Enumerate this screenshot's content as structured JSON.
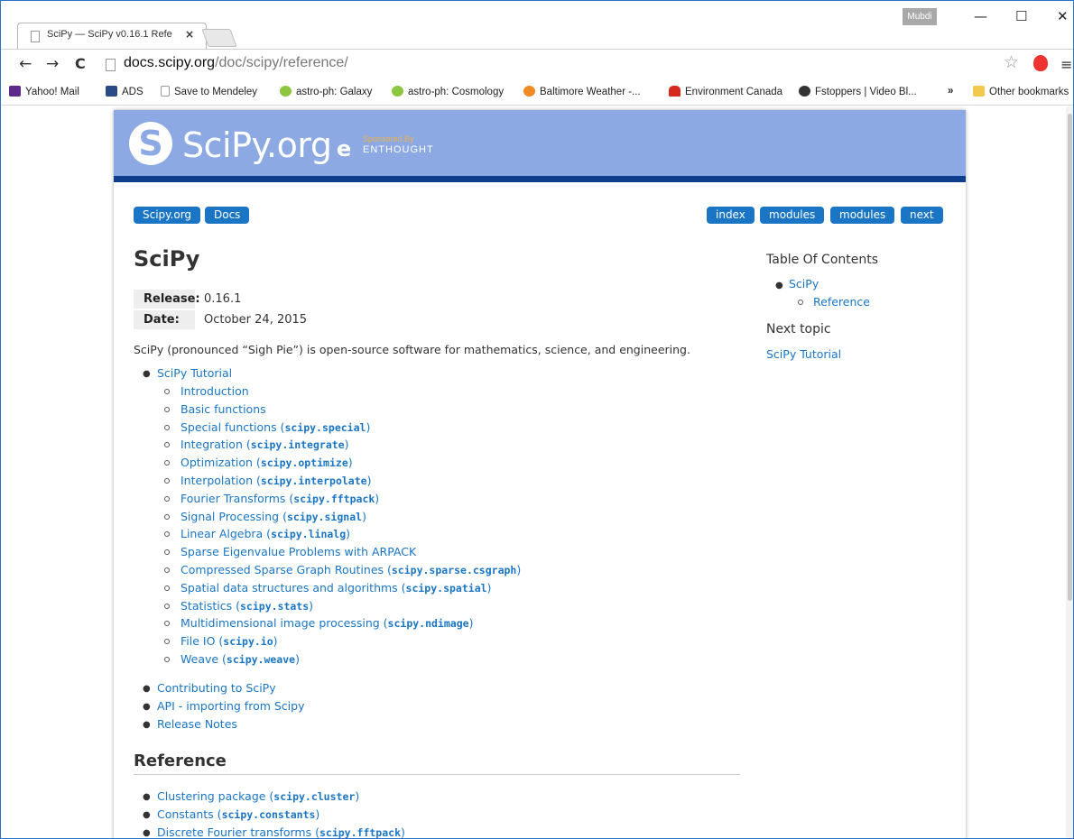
{
  "browser": {
    "tab_title": "SciPy — SciPy v0.16.1 Refe",
    "tab_close": "×",
    "profile_name": "Mubdi",
    "controls": {
      "minimize": "—",
      "maximize": "☐",
      "close": "✕"
    },
    "url_host": "docs.scipy.org",
    "url_path": "/doc/scipy/reference/",
    "menu_glyph": "≡",
    "star_glyph": "☆",
    "nav": {
      "back": "←",
      "forward": "→",
      "reload": "C"
    }
  },
  "bookmarks": [
    {
      "label": "Yahoo! Mail",
      "icon": "mail-icon",
      "color": "#5c2a8a"
    },
    {
      "label": "ADS",
      "icon": "ads-icon",
      "color": "#2a4a86"
    },
    {
      "label": "Save to Mendeley",
      "icon": "page-icon",
      "color": "#ffffff"
    },
    {
      "label": "astro-ph: Galaxy",
      "icon": "smiley-icon",
      "color": "#8dc63f"
    },
    {
      "label": "astro-ph: Cosmology",
      "icon": "smiley-icon",
      "color": "#8dc63f"
    },
    {
      "label": "Baltimore Weather -...",
      "icon": "sun-icon",
      "color": "#f08a24"
    },
    {
      "label": "Environment Canada",
      "icon": "maple-leaf-icon",
      "color": "#d52b1e"
    },
    {
      "label": "Fstoppers | Video Bl...",
      "icon": "fstoppers-icon",
      "color": "#333333"
    }
  ],
  "bookmarks_overflow": "»",
  "other_bookmarks": "Other bookmarks",
  "site": {
    "logo_text": "SciPy.org",
    "sponsor_small": "Sponsored By",
    "sponsor_big": "ENTHOUGHT",
    "header_color": "#8ca9e4",
    "link_color": "#1a75c4"
  },
  "breadcrumbs": [
    "Scipy.org",
    "Docs"
  ],
  "relbar": [
    "index",
    "modules",
    "modules",
    "next"
  ],
  "page_title": "SciPy",
  "fields": {
    "release_label": "Release:",
    "release_value": "0.16.1",
    "date_label": "Date:",
    "date_value": "October 24, 2015"
  },
  "intro": "SciPy (pronounced “Sigh Pie”) is open-source software for mathematics, science, and engineering.",
  "toc": {
    "tutorial": "SciPy Tutorial",
    "tutorial_items": [
      {
        "text": "Introduction",
        "code": ""
      },
      {
        "text": "Basic functions",
        "code": ""
      },
      {
        "text": "Special functions (",
        "code": "scipy.special",
        "tail": ")"
      },
      {
        "text": "Integration (",
        "code": "scipy.integrate",
        "tail": ")"
      },
      {
        "text": "Optimization (",
        "code": "scipy.optimize",
        "tail": ")"
      },
      {
        "text": "Interpolation (",
        "code": "scipy.interpolate",
        "tail": ")"
      },
      {
        "text": "Fourier Transforms (",
        "code": "scipy.fftpack",
        "tail": ")"
      },
      {
        "text": "Signal Processing (",
        "code": "scipy.signal",
        "tail": ")"
      },
      {
        "text": "Linear Algebra (",
        "code": "scipy.linalg",
        "tail": ")"
      },
      {
        "text": "Sparse Eigenvalue Problems with ARPACK",
        "code": ""
      },
      {
        "text": "Compressed Sparse Graph Routines (",
        "code": "scipy.sparse.csgraph",
        "tail": ")"
      },
      {
        "text": "Spatial data structures and algorithms (",
        "code": "scipy.spatial",
        "tail": ")"
      },
      {
        "text": "Statistics (",
        "code": "scipy.stats",
        "tail": ")"
      },
      {
        "text": "Multidimensional image processing (",
        "code": "scipy.ndimage",
        "tail": ")"
      },
      {
        "text": "File IO (",
        "code": "scipy.io",
        "tail": ")"
      },
      {
        "text": "Weave (",
        "code": "scipy.weave",
        "tail": ")"
      }
    ],
    "others": [
      "Contributing to SciPy",
      "API - importing from Scipy",
      "Release Notes"
    ]
  },
  "reference_heading": "Reference",
  "reference_items": [
    {
      "text": "Clustering package (",
      "code": "scipy.cluster",
      "tail": ")"
    },
    {
      "text": "Constants (",
      "code": "scipy.constants",
      "tail": ")"
    },
    {
      "text": "Discrete Fourier transforms (",
      "code": "scipy.fftpack",
      "tail": ")"
    }
  ],
  "sidebar": {
    "toc_heading": "Table Of Contents",
    "toc_items": [
      "SciPy",
      "Reference"
    ],
    "next_heading": "Next topic",
    "next_link": "SciPy Tutorial"
  }
}
